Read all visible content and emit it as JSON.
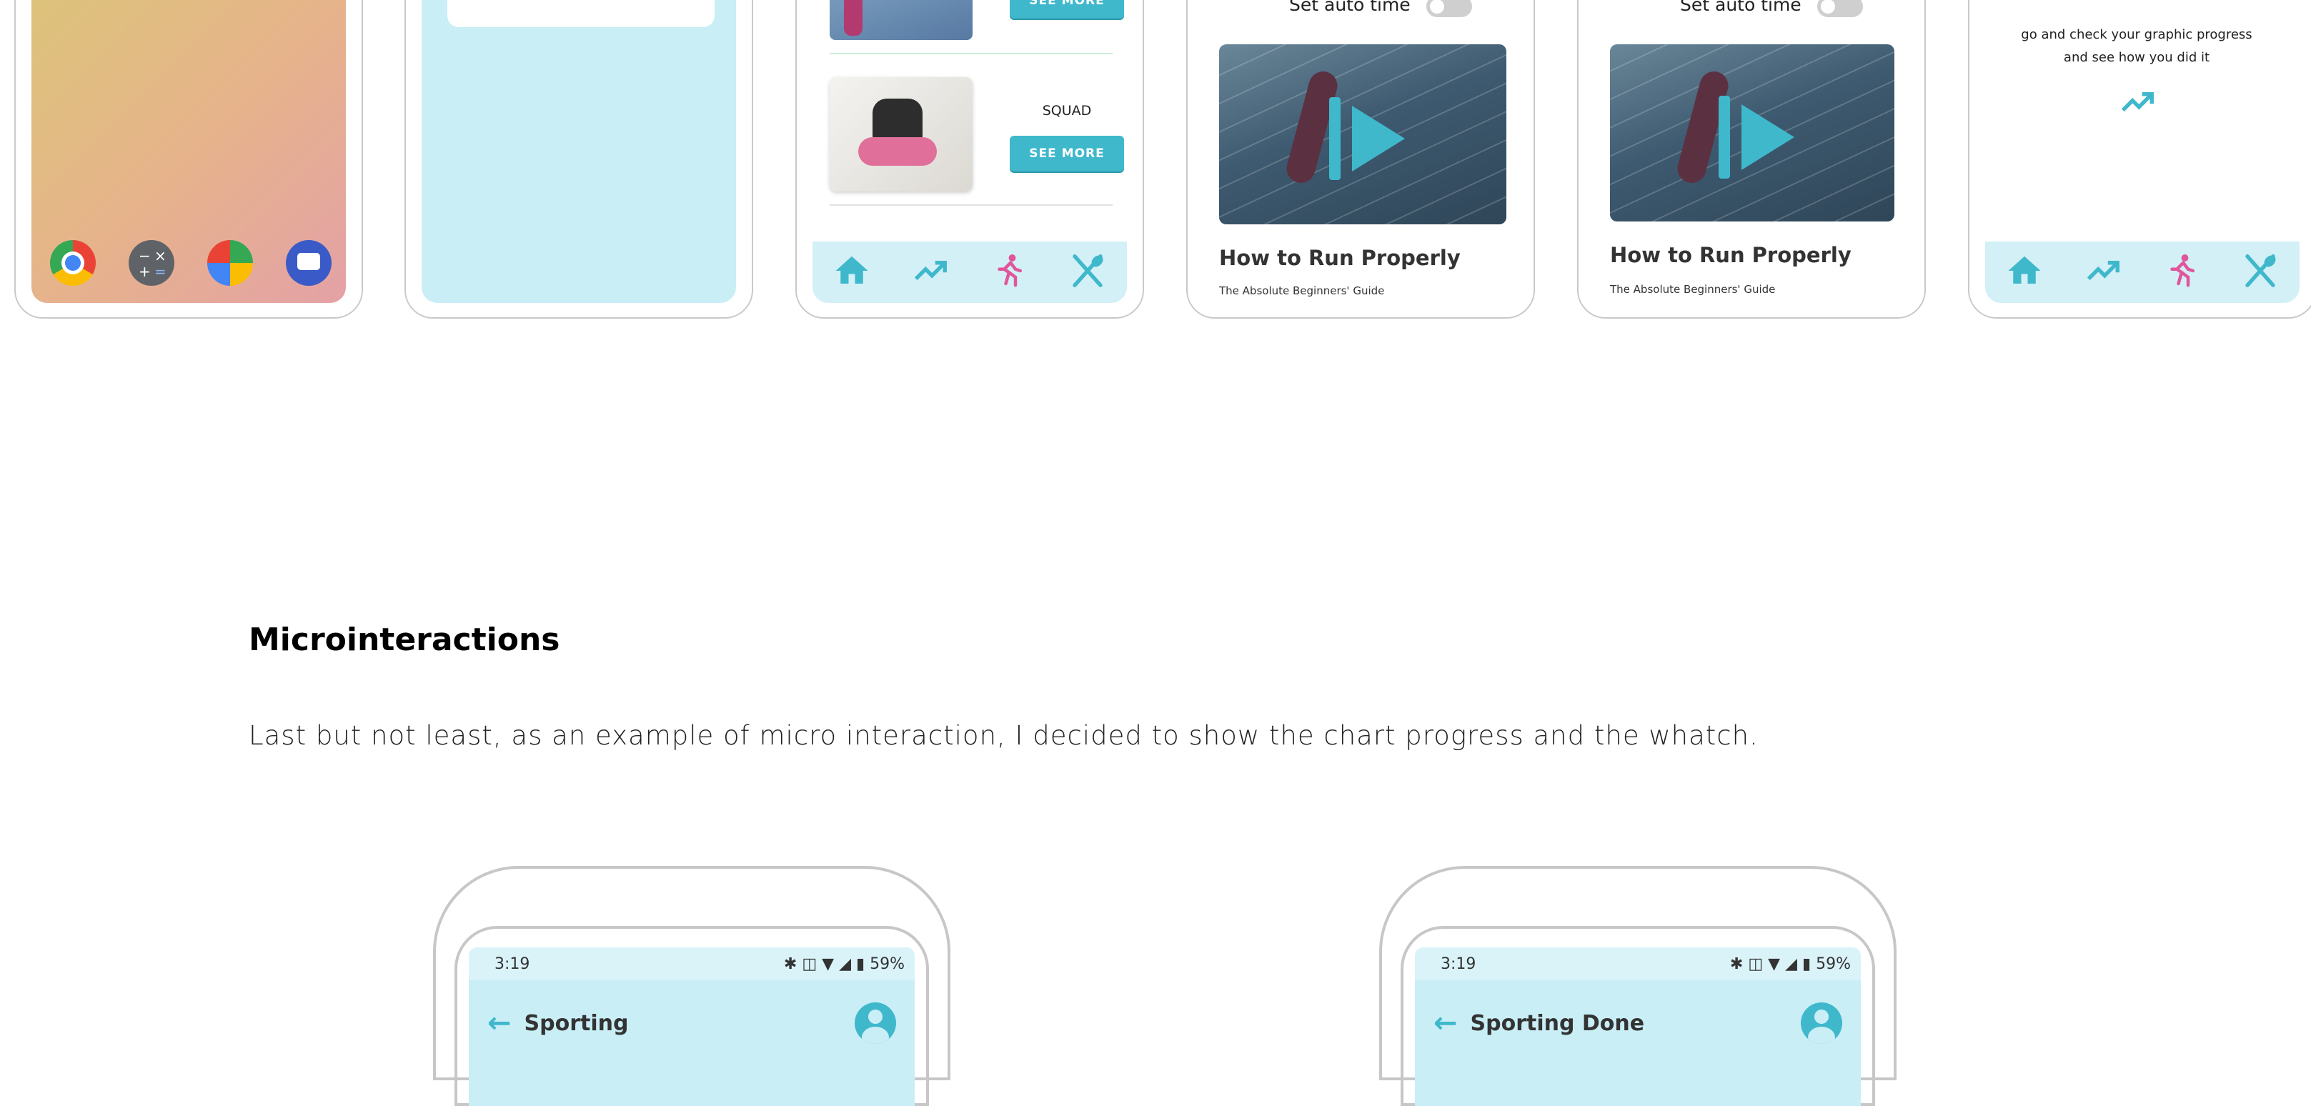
{
  "dock_icons": [
    "chrome-icon",
    "calculator-icon",
    "maps-icon",
    "messages-icon"
  ],
  "exercise_card": {
    "title": "SQUAD",
    "button_label": "SEE MORE"
  },
  "video_screen_1": {
    "toggle_label": "Set auto time",
    "video_title": "How to Run Properly",
    "video_subtitle": "The Absolute Beginners' Guide"
  },
  "video_screen_2": {
    "toggle_label": "Set auto time",
    "video_title": "How to Run Properly",
    "video_subtitle": "The Absolute Beginners' Guide"
  },
  "progress_screen": {
    "message_line1": "go and check your graphic progress",
    "message_line2": "and see how you did it"
  },
  "nav_icons": [
    "home-icon",
    "chart-icon",
    "run-icon",
    "cutlery-icon"
  ],
  "section": {
    "heading": "Microinteractions",
    "body": "Last but not least, as an example of micro interaction, I decided to show the chart progress and the whatch."
  },
  "mockup_left": {
    "time": "3:19",
    "battery": "59%",
    "title": "Sporting"
  },
  "mockup_right": {
    "time": "3:19",
    "battery": "59%",
    "title": "Sporting Done"
  },
  "colors": {
    "accent": "#3fb8cc",
    "nav_bg": "#d3f0f7",
    "pink": "#e0569b"
  }
}
